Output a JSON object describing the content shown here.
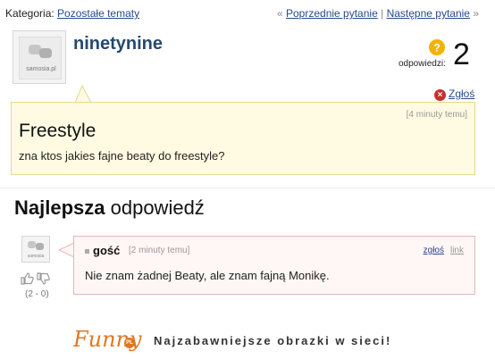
{
  "topbar": {
    "category_label": "Kategoria:",
    "category_link": "Pozostałe tematy",
    "prev_arrow": "«",
    "prev_link": "Poprzednie pytanie",
    "divider": "|",
    "next_link": "Następne pytanie",
    "next_arrow": "»"
  },
  "question": {
    "username": "ninetynine",
    "avatar_caption": "samosia.pl",
    "answers_label": "odpowiedzi:",
    "answers_count": "2",
    "report_label": "Zgłoś",
    "time": "[4 minuty temu]",
    "title": "Freestyle",
    "body": "zna ktos jakies fajne beaty do freestyle?"
  },
  "best_answer": {
    "heading_bold": "Najlepsza",
    "heading_rest": " odpowiedź",
    "avatar_caption": "samosia",
    "score": "(2 - 0)",
    "author": "gość",
    "time": "[2 minuty temu]",
    "report_label": "zgłoś",
    "link_label": "link",
    "body": "Nie znam żadnej Beaty, ale znam fajną Monikę."
  },
  "footer": {
    "logo_text": "Funny",
    "logo_badge": "PL",
    "tagline": "Najzabawniejsze obrazki w sieci!"
  },
  "colors": {
    "link": "#2a4a8c",
    "username": "#25496f",
    "question_bg": "#fffbe2",
    "answer_bg": "#fff6f6",
    "accent": "#e07820"
  }
}
